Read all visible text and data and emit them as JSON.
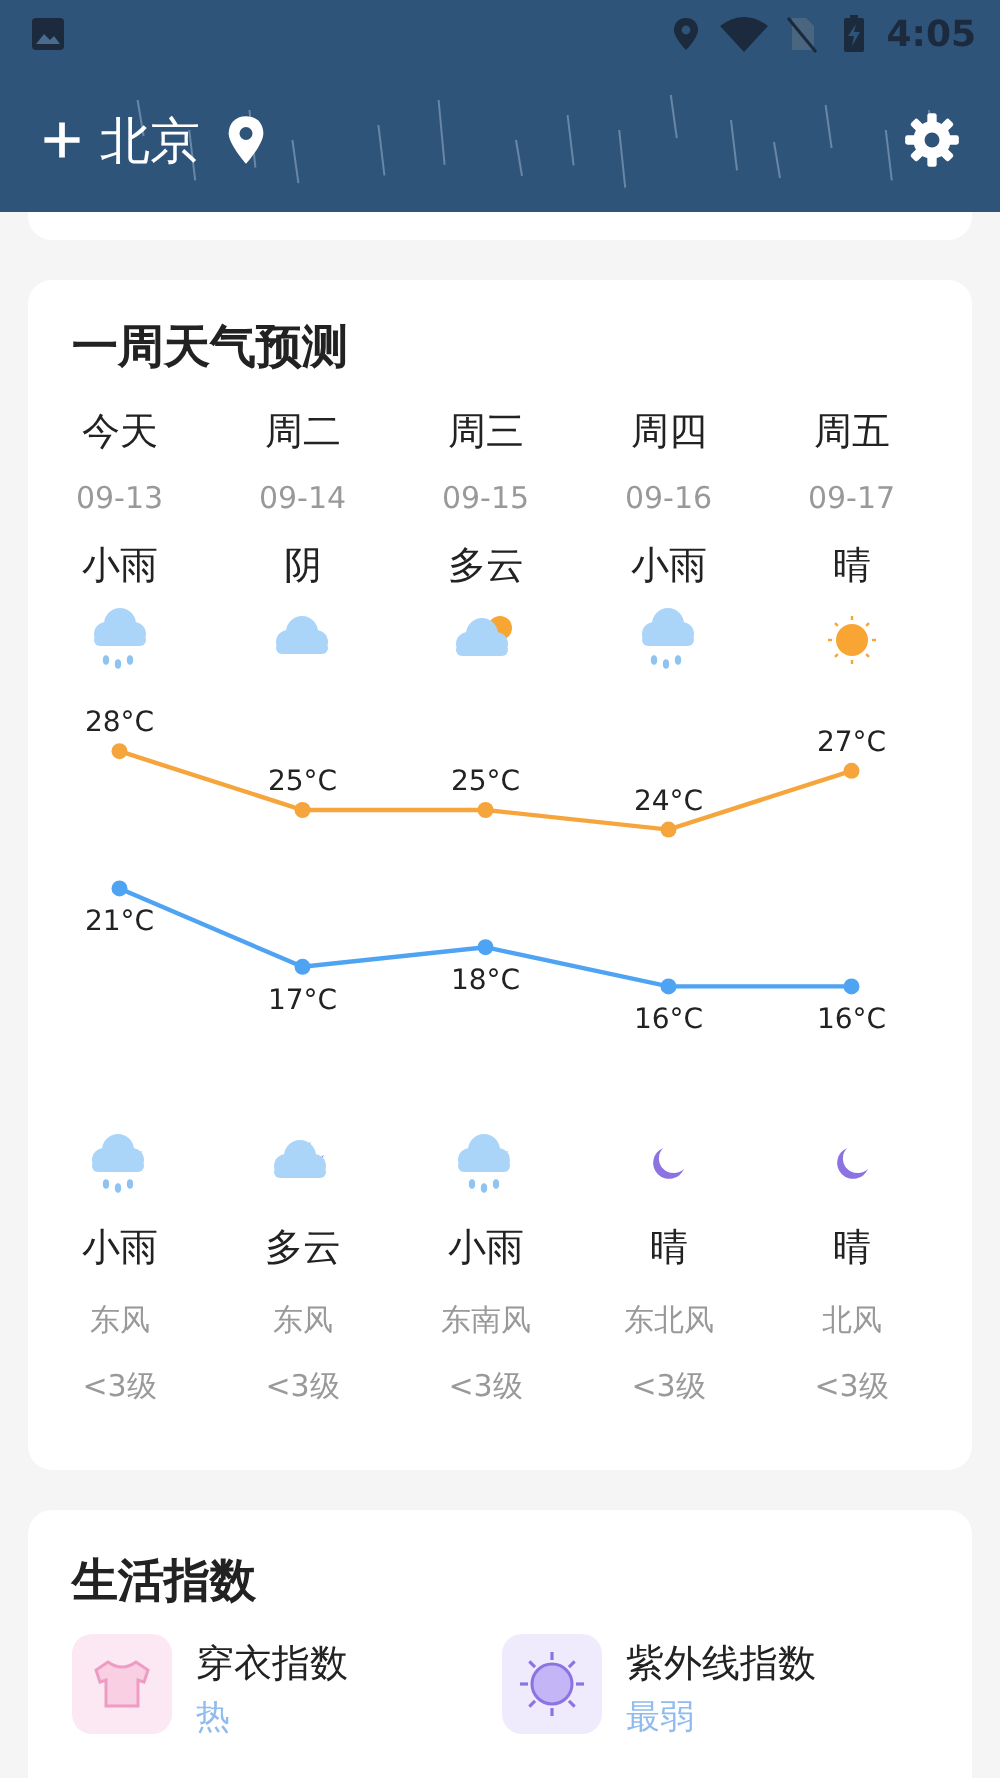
{
  "status_bar": {
    "time": "4:05"
  },
  "header": {
    "city": "北京"
  },
  "forecast": {
    "title": "一周天气预测",
    "days": [
      {
        "weekday": "今天",
        "date": "09-13",
        "daytime": {
          "kind": "rain",
          "weather": "小雨"
        },
        "nighttime": {
          "kind": "night-rain",
          "weather": "小雨"
        },
        "wind": "东风",
        "wind_level": "<3级"
      },
      {
        "weekday": "周二",
        "date": "09-14",
        "daytime": {
          "kind": "cloudy",
          "weather": "阴"
        },
        "nighttime": {
          "kind": "night-cloudy",
          "weather": "多云"
        },
        "wind": "东风",
        "wind_level": "<3级"
      },
      {
        "weekday": "周三",
        "date": "09-15",
        "daytime": {
          "kind": "partly",
          "weather": "多云"
        },
        "nighttime": {
          "kind": "night-rain",
          "weather": "小雨"
        },
        "wind": "东南风",
        "wind_level": "<3级"
      },
      {
        "weekday": "周四",
        "date": "09-16",
        "daytime": {
          "kind": "rain",
          "weather": "小雨"
        },
        "nighttime": {
          "kind": "night-clear",
          "weather": "晴"
        },
        "wind": "东北风",
        "wind_level": "<3级"
      },
      {
        "weekday": "周五",
        "date": "09-17",
        "daytime": {
          "kind": "sunny",
          "weather": "晴"
        },
        "nighttime": {
          "kind": "night-clear",
          "weather": "晴"
        },
        "wind": "北风",
        "wind_level": "<3级"
      }
    ],
    "chart_data": {
      "type": "line",
      "data_labels": true,
      "series": [
        {
          "color": "#f5a53c",
          "marker": true,
          "values": [
            28,
            25,
            25,
            24,
            27
          ],
          "value_labels": [
            "28°C",
            "25°C",
            "25°C",
            "24°C",
            "27°C"
          ]
        },
        {
          "color": "#4fa3f3",
          "marker": true,
          "values": [
            21,
            17,
            18,
            16,
            16
          ],
          "value_labels": [
            "21°C",
            "17°C",
            "18°C",
            "16°C",
            "16°C"
          ]
        }
      ]
    }
  },
  "life": {
    "title": "生活指数",
    "items": [
      {
        "kind": "shirt",
        "name": "穿衣指数",
        "value": "热"
      },
      {
        "kind": "uv",
        "name": "紫外线指数",
        "value": "最弱"
      }
    ]
  }
}
